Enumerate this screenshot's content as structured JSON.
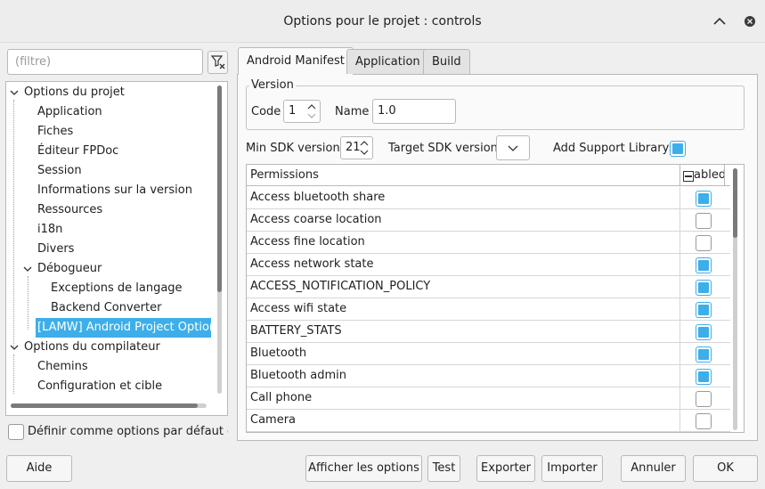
{
  "window": {
    "title": "Options pour le projet : controls"
  },
  "filter": {
    "placeholder": "(filtre)"
  },
  "tree": {
    "items": [
      {
        "label": "Options du projet"
      },
      {
        "label": "Application"
      },
      {
        "label": "Fiches"
      },
      {
        "label": "Éditeur FPDoc"
      },
      {
        "label": "Session"
      },
      {
        "label": "Informations sur la version"
      },
      {
        "label": "Ressources"
      },
      {
        "label": "i18n"
      },
      {
        "label": "Divers"
      },
      {
        "label": "Débogueur"
      },
      {
        "label": "Exceptions de langage"
      },
      {
        "label": "Backend Converter"
      },
      {
        "label": "[LAMW] Android Project Options"
      },
      {
        "label": "Options du compilateur"
      },
      {
        "label": "Chemins"
      },
      {
        "label": "Configuration et cible"
      }
    ]
  },
  "default_options": {
    "label": "Définir comme options par défaut d",
    "checked": false
  },
  "tabs": [
    {
      "label": "Android Manifest",
      "active": true
    },
    {
      "label": "Application",
      "active": false
    },
    {
      "label": "Build",
      "active": false
    }
  ],
  "version": {
    "title": "Version",
    "code_label": "Code",
    "code_value": "1",
    "name_label": "Name",
    "name_value": "1.0"
  },
  "sdk": {
    "min_label": "Min SDK version:",
    "min_value": "21",
    "target_label": "Target SDK version:",
    "target_value": "",
    "support_label": "Add Support Library:",
    "support_checked": true
  },
  "permissions": {
    "header_name": "Permissions",
    "header_enabled": "abled",
    "rows": [
      {
        "name": "Access bluetooth share",
        "enabled": true
      },
      {
        "name": "Access coarse location",
        "enabled": false
      },
      {
        "name": "Access fine location",
        "enabled": false
      },
      {
        "name": "Access network state",
        "enabled": true
      },
      {
        "name": "ACCESS_NOTIFICATION_POLICY",
        "enabled": true
      },
      {
        "name": "Access wifi state",
        "enabled": true
      },
      {
        "name": "BATTERY_STATS",
        "enabled": true
      },
      {
        "name": "Bluetooth",
        "enabled": true
      },
      {
        "name": "Bluetooth admin",
        "enabled": true
      },
      {
        "name": "Call phone",
        "enabled": false
      },
      {
        "name": "Camera",
        "enabled": false
      }
    ]
  },
  "buttons": {
    "help": "Aide",
    "show_options": "Afficher les options",
    "test": "Test",
    "export": "Exporter",
    "import": "Importer",
    "cancel": "Annuler",
    "ok": "OK"
  },
  "colors": {
    "accent": "#3daee9"
  }
}
